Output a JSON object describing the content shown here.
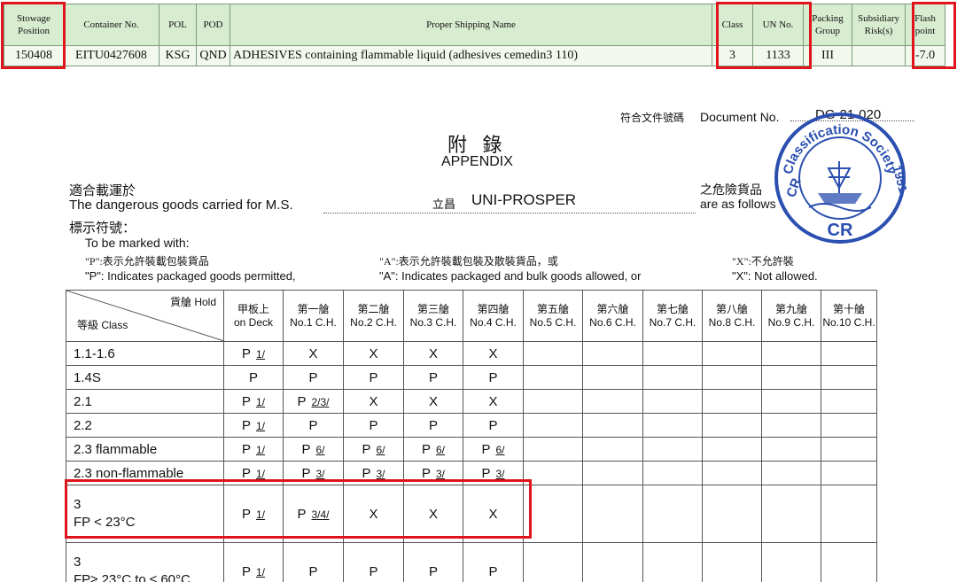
{
  "manifest": {
    "headers": [
      "Stowage Position",
      "Container No.",
      "POL",
      "POD",
      "Proper Shipping Name",
      "Class",
      "UN No.",
      "Packing Group",
      "Subsidiary Risk(s)",
      "Flash point"
    ],
    "row": [
      "150408",
      "EITU0427608",
      "KSG",
      "QND",
      "ADHESIVES containing flammable liquid (adhesives cemedin3 110)",
      "3",
      "1133",
      "III",
      "",
      "-7.0"
    ],
    "highlight_color": "#e0141c"
  },
  "appendix": {
    "docno_zh": "符合文件號碼",
    "docno_label": "Document No.",
    "docno_value": "DG-21-020",
    "title_zh": "附 錄",
    "title_en": "APPENDIX",
    "carried_zh": "適合載運於",
    "carried_en": "The dangerous goods carried for M.S.",
    "ship_zh": "立昌",
    "ship_name": "UNI-PROSPER",
    "follows_zh": "之危險貨品",
    "follows_en": "are as follows",
    "marking_zh": "標示符號：",
    "marking_en": "To be marked with:",
    "p_zh": "\"P\":表示允許裝載包裝貨品",
    "p_en": "\"P\": Indicates packaged goods permitted,",
    "a_zh": "\"A\":表示允許裝載包裝及散裝貨品，或",
    "a_en": "\"A\": Indicates packaged and bulk goods allowed, or",
    "x_zh": "\"X\":不允許裝",
    "x_en": "\"X\": Not allowed.",
    "stamp": {
      "text_top": "Classification Society",
      "left": "CR",
      "right": "1951",
      "bottom": "CR",
      "color": "#2a4fb0"
    },
    "table": {
      "corner_hold": "貨艙 Hold",
      "corner_class": "等級 Class",
      "columns": [
        {
          "zh": "甲板上",
          "en": "on Deck"
        },
        {
          "zh": "第一艙",
          "en": "No.1 C.H."
        },
        {
          "zh": "第二艙",
          "en": "No.2 C.H."
        },
        {
          "zh": "第三艙",
          "en": "No.3 C.H."
        },
        {
          "zh": "第四艙",
          "en": "No.4 C.H."
        },
        {
          "zh": "第五艙",
          "en": "No.5 C.H."
        },
        {
          "zh": "第六艙",
          "en": "No.6 C.H."
        },
        {
          "zh": "第七艙",
          "en": "No.7 C.H."
        },
        {
          "zh": "第八艙",
          "en": "No.8 C.H."
        },
        {
          "zh": "第九艙",
          "en": "No.9 C.H."
        },
        {
          "zh": "第十艙",
          "en": "No.10 C.H."
        }
      ],
      "rows": [
        {
          "cls": [
            "1.1-1.6"
          ],
          "cells": [
            [
              "P",
              "1/"
            ],
            [
              "X"
            ],
            [
              "X"
            ],
            [
              "X"
            ],
            [
              "X"
            ],
            [],
            [],
            [],
            [],
            [],
            []
          ]
        },
        {
          "cls": [
            "1.4S"
          ],
          "cells": [
            [
              "P"
            ],
            [
              "P"
            ],
            [
              "P"
            ],
            [
              "P"
            ],
            [
              "P"
            ],
            [],
            [],
            [],
            [],
            [],
            []
          ]
        },
        {
          "cls": [
            "2.1"
          ],
          "cells": [
            [
              "P",
              "1/"
            ],
            [
              "P",
              "2/3/"
            ],
            [
              "X"
            ],
            [
              "X"
            ],
            [
              "X"
            ],
            [],
            [],
            [],
            [],
            [],
            []
          ]
        },
        {
          "cls": [
            "2.2"
          ],
          "cells": [
            [
              "P",
              "1/"
            ],
            [
              "P"
            ],
            [
              "P"
            ],
            [
              "P"
            ],
            [
              "P"
            ],
            [],
            [],
            [],
            [],
            [],
            []
          ]
        },
        {
          "cls": [
            "2.3 flammable"
          ],
          "cells": [
            [
              "P",
              "1/"
            ],
            [
              "P",
              "6/"
            ],
            [
              "P",
              "6/"
            ],
            [
              "P",
              "6/"
            ],
            [
              "P",
              "6/"
            ],
            [],
            [],
            [],
            [],
            [],
            []
          ]
        },
        {
          "cls": [
            "2.3 non-flammable"
          ],
          "cells": [
            [
              "P",
              "1/"
            ],
            [
              "P",
              "3/"
            ],
            [
              "P",
              "3/"
            ],
            [
              "P",
              "3/"
            ],
            [
              "P",
              "3/"
            ],
            [],
            [],
            [],
            [],
            [],
            []
          ]
        },
        {
          "cls": [
            "3",
            "FP < 23°C"
          ],
          "cells": [
            [
              "P",
              "1/"
            ],
            [
              "P",
              "3/4/"
            ],
            [
              "X"
            ],
            [
              "X"
            ],
            [
              "X"
            ],
            [],
            [],
            [],
            [],
            [],
            []
          ]
        },
        {
          "cls": [
            "3",
            "FP≥ 23°C to ≤ 60°C"
          ],
          "cells": [
            [
              "P",
              "1/"
            ],
            [
              "P"
            ],
            [
              "P"
            ],
            [
              "P"
            ],
            [
              "P"
            ],
            [],
            [],
            [],
            [],
            [],
            []
          ]
        }
      ]
    }
  }
}
